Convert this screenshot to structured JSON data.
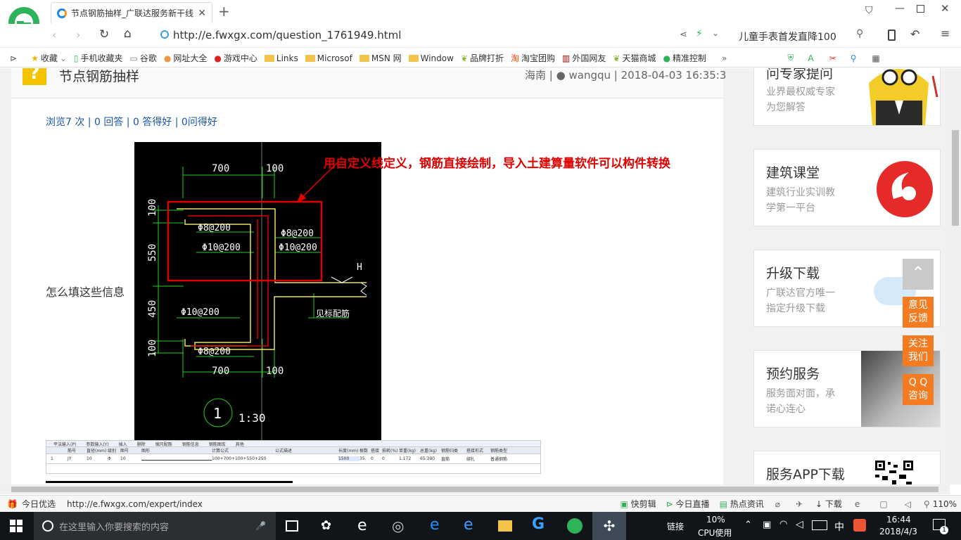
{
  "tab": {
    "title": "节点钢筋抽样_广联达服务新干线"
  },
  "address": {
    "url": "http://e.fwxgx.com/question_1761949.html",
    "search_hint": "儿童手表首发直降100"
  },
  "bookmarks": [
    "收藏",
    "手机收藏夹",
    "谷歌",
    "网址大全",
    "游戏中心",
    "Links",
    "Microsof",
    "MSN 网",
    "Window",
    "品牌打折",
    "淘宝团购",
    "外国网友",
    "天猫商城",
    "精准控制"
  ],
  "question": {
    "title": "节点钢筋抽样",
    "region": "海南",
    "user": "wangqu",
    "date": "2018-04-03 16:35:3",
    "stats": "浏览7 次 | 0 回答 | 0 答得好 | 0问得好",
    "body": "怎么填这些信息"
  },
  "drawing": {
    "annotation": "用自定义线定义，钢筋直接绘制，导入土建算量软件可以构件转换",
    "dims_top": [
      "700",
      "100"
    ],
    "dims_bottom": [
      "700",
      "100"
    ],
    "dims_left": [
      "100",
      "550",
      "450",
      "100"
    ],
    "rebar": [
      "Φ8@200",
      "Φ10@200",
      "Φ8@200",
      "Φ10@200",
      "Φ10@200",
      "Φ8@200"
    ],
    "note": "见标配筋",
    "h_label": "H",
    "circle_num": "1",
    "scale": "1:30"
  },
  "table": {
    "toolbar": [
      "平法输入(P)",
      "参数输入(Y)",
      "插入",
      "删除",
      "缩尺配筋",
      "钢筋信息",
      "钢筋图库",
      "其他"
    ],
    "headers": [
      "筋号",
      "直径(mm)",
      "级别",
      "图号",
      "图形",
      "计算公式",
      "公式描述",
      "长度(mm)",
      "根数",
      "搭接",
      "损耗(%)",
      "单重(kg)",
      "总重(kg)",
      "钢筋归类",
      "搭接形式",
      "钢筋类型"
    ],
    "rows": [
      [
        "1",
        "JY",
        "10",
        "Φ",
        "10",
        "",
        "100+700+100+550+250",
        "",
        "1500",
        "35",
        "0",
        "0",
        "1.172",
        "65.300",
        "直筋",
        "绑扎",
        "普通钢筋"
      ]
    ]
  },
  "sidebar": [
    {
      "title": "问专家提问",
      "desc": [
        "业界最权威专家",
        "为您解答"
      ]
    },
    {
      "title": "建筑课堂",
      "desc": [
        "建筑行业实训教",
        "学第一平台"
      ]
    },
    {
      "title": "升级下载",
      "desc": [
        "广联达官方唯一",
        "指定升级下载"
      ]
    },
    {
      "title": "预约服务",
      "desc": [
        "服务面对面，承",
        "诺心连心"
      ]
    },
    {
      "title": "服务APP下载",
      "desc": []
    }
  ],
  "float": {
    "feedback": [
      "意见",
      "反馈"
    ],
    "follow": [
      "关注",
      "我们"
    ],
    "qq": [
      "Q Q",
      "咨询"
    ]
  },
  "status": {
    "left": "今日优选",
    "url": "http://e.fwxgx.com/expert/index",
    "items": [
      "快剪辑",
      "今日直播",
      "热点资讯",
      "下载"
    ],
    "zoom": "110%"
  },
  "taskbar": {
    "search": "在这里输入你要搜索的内容",
    "link": "链接",
    "cpu_pct": "10%",
    "cpu_label": "CPU使用",
    "ime": "中",
    "time": "16:44",
    "date": "2018/4/3",
    "notif": "1"
  },
  "colors": {
    "accent": "#f57b20",
    "link": "#1a55a8",
    "annotation": "#e00000"
  }
}
